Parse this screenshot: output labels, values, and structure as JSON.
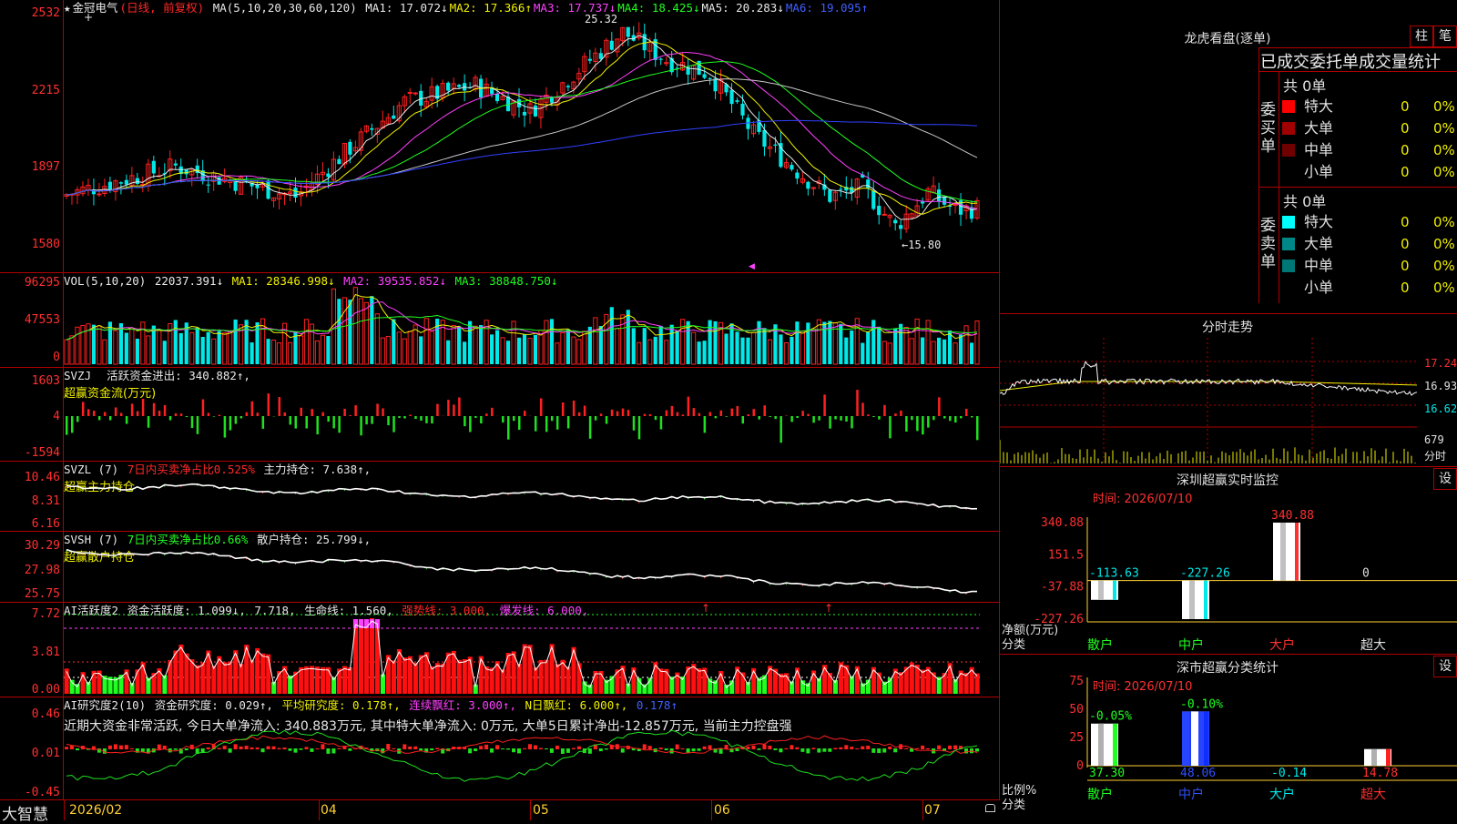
{
  "stock": {
    "name": "金冠电气",
    "mode": "(日线, 前复权)",
    "ma_header": "MA(5,10,20,30,60,120)",
    "ma_values": [
      {
        "label": "MA1: 17.072↓",
        "color": "#e8e8e8"
      },
      {
        "label": "MA2: 17.366↑",
        "color": "#f0f000"
      },
      {
        "label": "MA3: 17.737↓",
        "color": "#ff40ff"
      },
      {
        "label": "MA4: 18.425↓",
        "color": "#20ff20"
      },
      {
        "label": "MA5: 20.283↓",
        "color": "#e8e8e8"
      },
      {
        "label": "MA6: 19.095↑",
        "color": "#4060ff"
      }
    ],
    "price_axis": [
      "2532",
      "2215",
      "1897",
      "1580"
    ],
    "high_label": "25.32",
    "low_label": "←15.80"
  },
  "vol": {
    "header": "VOL(5,10,20)",
    "value": "22037.391↓",
    "ma1": "MA1: 28346.998↓",
    "ma2": "MA2: 39535.852↓",
    "ma3": "MA3: 38848.750↓",
    "axis": [
      "96295",
      "47553",
      "0"
    ]
  },
  "svzj": {
    "header": "SVZJ",
    "label": "活跃资金进出: 340.882↑,",
    "sub": "超赢资金流(万元)",
    "axis": [
      "1603",
      "4",
      "-1594"
    ]
  },
  "svzl": {
    "header": "SVZL (7)",
    "ratio": "7日内买卖净占比0.525%",
    "hold": "主力持仓: 7.638↑,",
    "sub": "超赢主力持仓",
    "axis": [
      "10.46",
      "8.31",
      "6.16"
    ]
  },
  "svsh": {
    "header": "SVSH (7)",
    "ratio": "7日内买卖净占比0.66%",
    "hold": "散户持仓: 25.799↓,",
    "sub": "超赢散户持仓",
    "axis": [
      "30.29",
      "27.98",
      "25.75"
    ]
  },
  "ai_active": {
    "header": "AI活跃度2",
    "active": "资金活跃度: 1.099↓,",
    "active2": "7.718,",
    "life": "生命线: 1.560,",
    "strong": "强势线: 3.000,",
    "burst": "爆发线: 6.000,",
    "axis": [
      "7.72",
      "3.81",
      "0.00"
    ]
  },
  "ai_research": {
    "header": "AI研究度2(10)",
    "research": "资金研究度: 0.029↑,",
    "avg": "平均研究度: 0.178↑,",
    "red": "连续飘红: 3.000↑,",
    "nred": "N日飘红: 6.000↑,",
    "last": "0.178↑",
    "comment": "近期大资金非常活跃, 今日大单净流入: 340.883万元, 其中特大单净流入: 0万元, 大单5日累计净出-12.857万元, 当前主力控盘强",
    "axis": [
      "0.46",
      "0.01",
      "-0.45"
    ]
  },
  "bottom": {
    "brand": "大智慧",
    "dates": [
      "2026/02",
      "04",
      "05",
      "06",
      "07"
    ]
  },
  "longhu": {
    "title": "龙虎看盘(逐单)",
    "btn1": "柱",
    "btn2": "笔",
    "subtitle": "已成交委托单成交量统计",
    "buy_label": "委买单",
    "sell_label": "委卖单",
    "buy_total": "共 0单",
    "sell_total": "共 0单",
    "buy_rows": [
      {
        "name": "特大",
        "count": "0",
        "pct": "0%",
        "color": "#ff0000"
      },
      {
        "name": "大单",
        "count": "0",
        "pct": "0%",
        "color": "#a00000"
      },
      {
        "name": "中单",
        "count": "0",
        "pct": "0%",
        "color": "#700000"
      },
      {
        "name": "小单",
        "count": "0",
        "pct": "0%",
        "color": ""
      }
    ],
    "sell_rows": [
      {
        "name": "特大",
        "count": "0",
        "pct": "0%",
        "color": "#00ffff"
      },
      {
        "name": "大单",
        "count": "0",
        "pct": "0%",
        "color": "#008888"
      },
      {
        "name": "中单",
        "count": "0",
        "pct": "0%",
        "color": "#007777"
      },
      {
        "name": "小单",
        "count": "0",
        "pct": "0%",
        "color": ""
      }
    ]
  },
  "fenshi": {
    "title": "分时走势",
    "axis": [
      "17.24",
      "16.93",
      "16.62"
    ],
    "vol_label": "679",
    "vol_sub": "分时"
  },
  "sz_monitor": {
    "title": "深圳超赢实时监控",
    "btn": "设",
    "time": "时间: 2026/07/10",
    "axis": [
      "340.88",
      "151.5",
      "-37.88",
      "-227.26"
    ],
    "ylabel1": "净额(万元)",
    "ylabel2": "分类",
    "bars": [
      {
        "cat": "散户",
        "value": -113.63,
        "label": "-113.63",
        "cat_color": "#20ff20",
        "lbl_color": "#00e8e8"
      },
      {
        "cat": "中户",
        "value": -227.26,
        "label": "-227.26",
        "cat_color": "#20ff20",
        "lbl_color": "#00e8e8"
      },
      {
        "cat": "大户",
        "value": 340.88,
        "label": "340.88",
        "cat_color": "#ff3030",
        "lbl_color": "#ff3030"
      },
      {
        "cat": "超大",
        "value": 0,
        "label": "0",
        "cat_color": "#e0e0e0",
        "lbl_color": "#e0e0e0"
      }
    ]
  },
  "sz_class": {
    "title": "深市超赢分类统计",
    "btn": "设",
    "time": "时间: 2026/07/10",
    "axis": [
      "75",
      "50",
      "25",
      "0"
    ],
    "ylabel1": "比例%",
    "ylabel2": "分类",
    "bars": [
      {
        "cat": "散户",
        "value": 37.3,
        "top": "-0.05%",
        "bottom": "37.30",
        "cat_color": "#20ff20",
        "top_color": "#20ff20",
        "bot_color": "#20ff20",
        "fill": "#20ff20"
      },
      {
        "cat": "中户",
        "value": 48.06,
        "top": "-0.10%",
        "bottom": "48.06",
        "cat_color": "#3050ff",
        "top_color": "#20ff20",
        "bot_color": "#3050ff",
        "fill": "#1030ff"
      },
      {
        "cat": "大户",
        "value": 0,
        "top": "",
        "bottom": "-0.14",
        "cat_color": "#00e8e8",
        "top_color": "#ff3030",
        "bot_color": "#00e8e8",
        "fill": "#00e8e8"
      },
      {
        "cat": "超大",
        "value": 14.78,
        "top": "",
        "bottom": "14.78",
        "cat_color": "#ff3030",
        "top_color": "#ff3030",
        "bot_color": "#ff3030",
        "fill": "#ff2020"
      }
    ]
  }
}
